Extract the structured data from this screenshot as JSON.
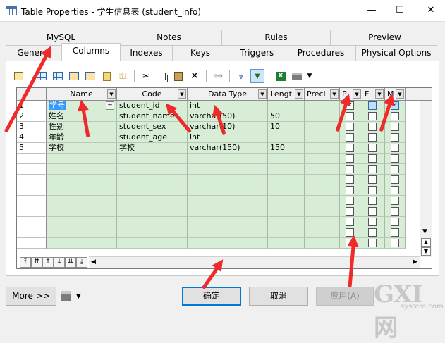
{
  "window": {
    "title": "Table Properties - 学生信息表 (student_info)",
    "minimize": "—",
    "maximize": "☐",
    "close": "✕"
  },
  "tabs_top": [
    {
      "label": "MySQL"
    },
    {
      "label": "Notes"
    },
    {
      "label": "Rules"
    },
    {
      "label": "Preview"
    }
  ],
  "tabs_bottom": [
    {
      "label": "General"
    },
    {
      "label": "Columns",
      "active": true
    },
    {
      "label": "Indexes"
    },
    {
      "label": "Keys"
    },
    {
      "label": "Triggers"
    },
    {
      "label": "Procedures"
    },
    {
      "label": "Physical Options"
    }
  ],
  "toolbar": {
    "icons": [
      "properties-icon",
      "insert-row-icon",
      "add-row-icon",
      "add-column-icon",
      "add-column-alt-icon",
      "new-doc-icon",
      "key-icon",
      "cut-icon",
      "copy-icon",
      "paste-icon",
      "delete-icon",
      "find-icon",
      "filter-icon",
      "customize-columns-icon",
      "excel-icon",
      "print-icon",
      "dropdown-icon"
    ]
  },
  "grid": {
    "headers": {
      "name": "Name",
      "code": "Code",
      "data_type": "Data Type",
      "length": "Lengt",
      "precision": "Preci",
      "p": "P",
      "f": "F",
      "m": "M"
    },
    "rows": [
      {
        "num": "1",
        "marker": "",
        "name": "学号",
        "code": "student_id",
        "type": "int",
        "length": "",
        "p": true,
        "f": false,
        "m": true
      },
      {
        "num": "2",
        "marker": "",
        "name": "姓名",
        "code": "student_name",
        "type": "varchar(50)",
        "length": "50",
        "p": false,
        "f": false,
        "m": false
      },
      {
        "num": "3",
        "marker": "",
        "name": "性别",
        "code": "student_sex",
        "type": "varchar(10)",
        "length": "10",
        "p": false,
        "f": false,
        "m": false
      },
      {
        "num": "4",
        "marker": "",
        "name": "年龄",
        "code": "student_age",
        "type": "int",
        "length": "",
        "p": false,
        "f": false,
        "m": false
      },
      {
        "num": "5",
        "marker": "",
        "name": "学校",
        "code": "学校",
        "type": "varchar(150)",
        "length": "150",
        "p": false,
        "f": false,
        "m": false
      }
    ],
    "empty_rows": 9,
    "edit_glyph": "="
  },
  "footer": {
    "more": "More >>",
    "ok": "确定",
    "cancel": "取消",
    "apply": "应用(A)"
  },
  "watermark": {
    "brand": "GXI网",
    "url": "system.com"
  },
  "colors": {
    "row_fill": "#d7edd6",
    "selection": "#3399ff",
    "arrow": "#ee2a2a",
    "ok_border": "#0078d7"
  }
}
